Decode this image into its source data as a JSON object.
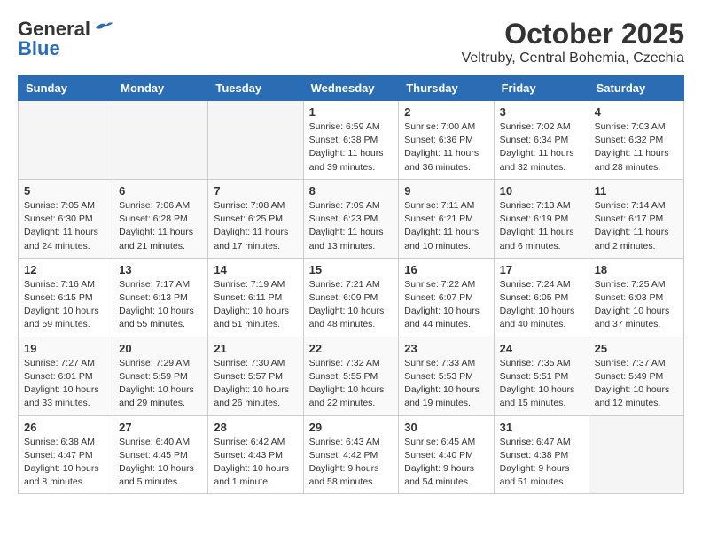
{
  "header": {
    "logo_general": "General",
    "logo_blue": "Blue",
    "title": "October 2025",
    "subtitle": "Veltruby, Central Bohemia, Czechia"
  },
  "weekdays": [
    "Sunday",
    "Monday",
    "Tuesday",
    "Wednesday",
    "Thursday",
    "Friday",
    "Saturday"
  ],
  "weeks": [
    [
      {
        "day": "",
        "info": ""
      },
      {
        "day": "",
        "info": ""
      },
      {
        "day": "",
        "info": ""
      },
      {
        "day": "1",
        "info": "Sunrise: 6:59 AM\nSunset: 6:38 PM\nDaylight: 11 hours\nand 39 minutes."
      },
      {
        "day": "2",
        "info": "Sunrise: 7:00 AM\nSunset: 6:36 PM\nDaylight: 11 hours\nand 36 minutes."
      },
      {
        "day": "3",
        "info": "Sunrise: 7:02 AM\nSunset: 6:34 PM\nDaylight: 11 hours\nand 32 minutes."
      },
      {
        "day": "4",
        "info": "Sunrise: 7:03 AM\nSunset: 6:32 PM\nDaylight: 11 hours\nand 28 minutes."
      }
    ],
    [
      {
        "day": "5",
        "info": "Sunrise: 7:05 AM\nSunset: 6:30 PM\nDaylight: 11 hours\nand 24 minutes."
      },
      {
        "day": "6",
        "info": "Sunrise: 7:06 AM\nSunset: 6:28 PM\nDaylight: 11 hours\nand 21 minutes."
      },
      {
        "day": "7",
        "info": "Sunrise: 7:08 AM\nSunset: 6:25 PM\nDaylight: 11 hours\nand 17 minutes."
      },
      {
        "day": "8",
        "info": "Sunrise: 7:09 AM\nSunset: 6:23 PM\nDaylight: 11 hours\nand 13 minutes."
      },
      {
        "day": "9",
        "info": "Sunrise: 7:11 AM\nSunset: 6:21 PM\nDaylight: 11 hours\nand 10 minutes."
      },
      {
        "day": "10",
        "info": "Sunrise: 7:13 AM\nSunset: 6:19 PM\nDaylight: 11 hours\nand 6 minutes."
      },
      {
        "day": "11",
        "info": "Sunrise: 7:14 AM\nSunset: 6:17 PM\nDaylight: 11 hours\nand 2 minutes."
      }
    ],
    [
      {
        "day": "12",
        "info": "Sunrise: 7:16 AM\nSunset: 6:15 PM\nDaylight: 10 hours\nand 59 minutes."
      },
      {
        "day": "13",
        "info": "Sunrise: 7:17 AM\nSunset: 6:13 PM\nDaylight: 10 hours\nand 55 minutes."
      },
      {
        "day": "14",
        "info": "Sunrise: 7:19 AM\nSunset: 6:11 PM\nDaylight: 10 hours\nand 51 minutes."
      },
      {
        "day": "15",
        "info": "Sunrise: 7:21 AM\nSunset: 6:09 PM\nDaylight: 10 hours\nand 48 minutes."
      },
      {
        "day": "16",
        "info": "Sunrise: 7:22 AM\nSunset: 6:07 PM\nDaylight: 10 hours\nand 44 minutes."
      },
      {
        "day": "17",
        "info": "Sunrise: 7:24 AM\nSunset: 6:05 PM\nDaylight: 10 hours\nand 40 minutes."
      },
      {
        "day": "18",
        "info": "Sunrise: 7:25 AM\nSunset: 6:03 PM\nDaylight: 10 hours\nand 37 minutes."
      }
    ],
    [
      {
        "day": "19",
        "info": "Sunrise: 7:27 AM\nSunset: 6:01 PM\nDaylight: 10 hours\nand 33 minutes."
      },
      {
        "day": "20",
        "info": "Sunrise: 7:29 AM\nSunset: 5:59 PM\nDaylight: 10 hours\nand 29 minutes."
      },
      {
        "day": "21",
        "info": "Sunrise: 7:30 AM\nSunset: 5:57 PM\nDaylight: 10 hours\nand 26 minutes."
      },
      {
        "day": "22",
        "info": "Sunrise: 7:32 AM\nSunset: 5:55 PM\nDaylight: 10 hours\nand 22 minutes."
      },
      {
        "day": "23",
        "info": "Sunrise: 7:33 AM\nSunset: 5:53 PM\nDaylight: 10 hours\nand 19 minutes."
      },
      {
        "day": "24",
        "info": "Sunrise: 7:35 AM\nSunset: 5:51 PM\nDaylight: 10 hours\nand 15 minutes."
      },
      {
        "day": "25",
        "info": "Sunrise: 7:37 AM\nSunset: 5:49 PM\nDaylight: 10 hours\nand 12 minutes."
      }
    ],
    [
      {
        "day": "26",
        "info": "Sunrise: 6:38 AM\nSunset: 4:47 PM\nDaylight: 10 hours\nand 8 minutes."
      },
      {
        "day": "27",
        "info": "Sunrise: 6:40 AM\nSunset: 4:45 PM\nDaylight: 10 hours\nand 5 minutes."
      },
      {
        "day": "28",
        "info": "Sunrise: 6:42 AM\nSunset: 4:43 PM\nDaylight: 10 hours\nand 1 minute."
      },
      {
        "day": "29",
        "info": "Sunrise: 6:43 AM\nSunset: 4:42 PM\nDaylight: 9 hours\nand 58 minutes."
      },
      {
        "day": "30",
        "info": "Sunrise: 6:45 AM\nSunset: 4:40 PM\nDaylight: 9 hours\nand 54 minutes."
      },
      {
        "day": "31",
        "info": "Sunrise: 6:47 AM\nSunset: 4:38 PM\nDaylight: 9 hours\nand 51 minutes."
      },
      {
        "day": "",
        "info": ""
      }
    ]
  ]
}
